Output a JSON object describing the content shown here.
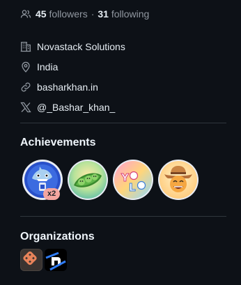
{
  "follow": {
    "followers_count": "45",
    "followers_label": "followers",
    "separator": "·",
    "following_count": "31",
    "following_label": "following"
  },
  "details": {
    "company": "Novastack Solutions",
    "location": "India",
    "website": "basharkhan.in",
    "social": "@_Bashar_khan_"
  },
  "achievements": {
    "title": "Achievements",
    "badges": [
      {
        "icon": "shark-badge-icon",
        "multiplier": "x2"
      },
      {
        "icon": "peas-badge-icon"
      },
      {
        "icon": "yolo-badge-icon"
      },
      {
        "icon": "cowboy-badge-icon"
      }
    ]
  },
  "organizations": {
    "title": "Organizations",
    "items": [
      {
        "icon": "org-logo-orange-icon"
      },
      {
        "icon": "org-logo-n-icon"
      }
    ]
  },
  "colors": {
    "background": "#0d1117",
    "text": "#e6edf3",
    "muted": "#9198a1",
    "divider": "#30363d",
    "x2_badge": "#f4a6a0"
  }
}
